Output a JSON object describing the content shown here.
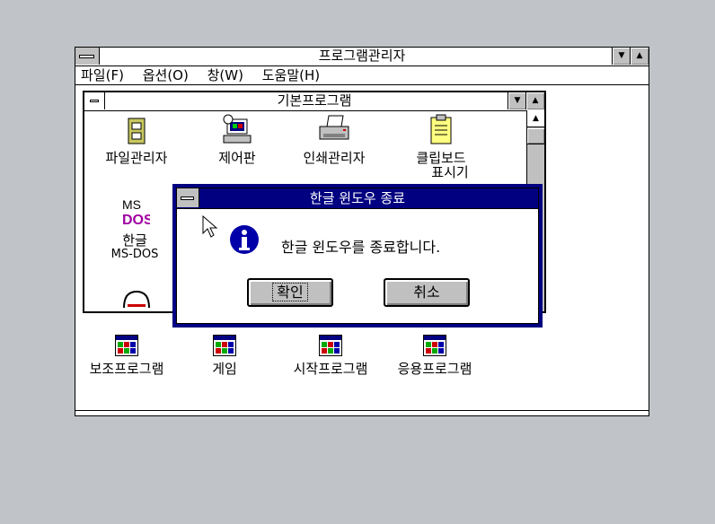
{
  "program_manager": {
    "title": "프로그램관리자",
    "menu": [
      "파일(F)",
      "옵션(O)",
      "창(W)",
      "도움말(H)"
    ]
  },
  "main_group": {
    "title": "기본프로그램",
    "icons": [
      {
        "label": "파일관리자",
        "icon": "file-cabinet-icon"
      },
      {
        "label": "제어판",
        "icon": "control-panel-icon"
      },
      {
        "label": "인쇄관리자",
        "icon": "printer-icon"
      },
      {
        "label": "클립보드",
        "icon": "clipboard-icon"
      },
      {
        "label": "표시기",
        "icon": "clipboard-icon"
      },
      {
        "label": "한글",
        "icon": "ms-dos-icon"
      },
      {
        "label": "MS-DOS",
        "icon": "ms-dos-icon"
      }
    ]
  },
  "group_icons": [
    "보조프로그램",
    "게임",
    "시작프로그램",
    "응용프로그램"
  ],
  "dialog": {
    "title": "한글 윈도우 종료",
    "message": "한글 윈도우를 종료합니다.",
    "ok_label": "확인",
    "cancel_label": "취소",
    "icon": "info-icon"
  },
  "colors": {
    "desktop": "#c0c4c8",
    "title_active": "#000080",
    "info_blue": "#0000a8"
  }
}
